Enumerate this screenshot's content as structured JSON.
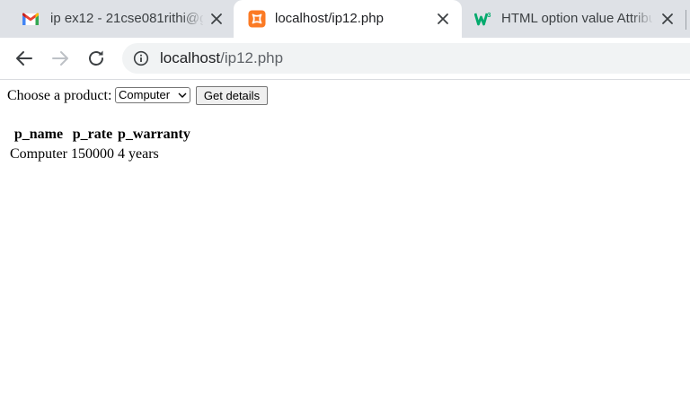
{
  "browser": {
    "tabs": [
      {
        "title": "ip ex12 - 21cse081rithi@g",
        "favicon": "gmail-icon",
        "active": false
      },
      {
        "title": "localhost/ip12.php",
        "favicon": "xampp-icon",
        "active": true
      },
      {
        "title": "HTML option value Attribu",
        "favicon": "w3schools-icon",
        "active": false
      }
    ],
    "address": {
      "host": "localhost",
      "path": "/ip12.php",
      "security_icon": "info-icon"
    },
    "nav_icons": [
      "back-arrow-icon",
      "forward-arrow-icon",
      "reload-icon"
    ]
  },
  "page": {
    "form": {
      "label": "Choose a product:",
      "select_value": "Computer",
      "submit_label": "Get details"
    },
    "table": {
      "headers": [
        "p_name",
        "p_rate",
        "p_warranty"
      ],
      "rows": [
        [
          "Computer",
          "150000",
          "4 years"
        ]
      ]
    }
  },
  "colors": {
    "tabstrip_bg": "#dee1e6",
    "omnibox_bg": "#f1f3f4",
    "gmail_red": "#ea4335",
    "xampp_orange": "#fb7a24",
    "w3schools_green": "#04aa6d"
  }
}
